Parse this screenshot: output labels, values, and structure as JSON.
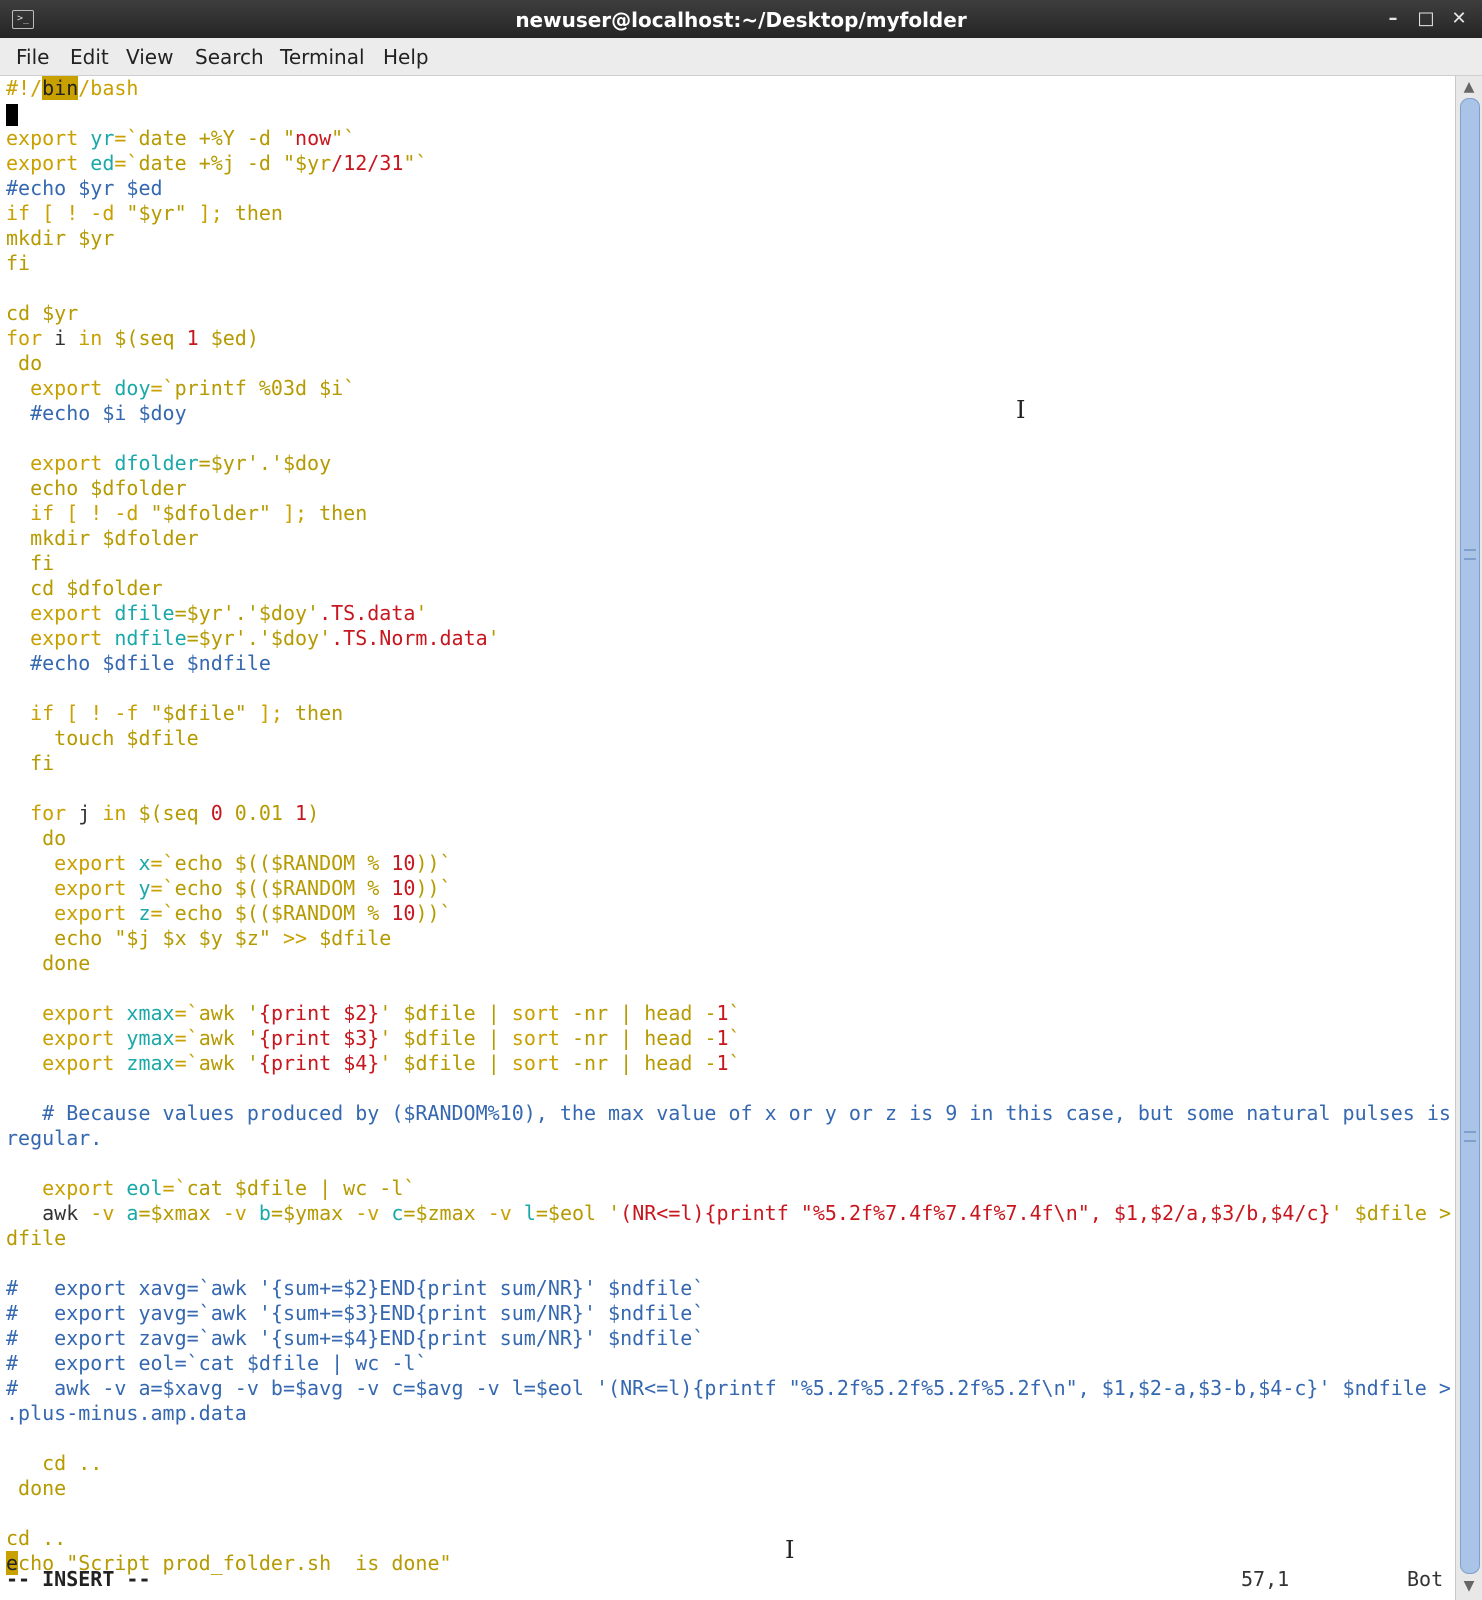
{
  "window": {
    "title": "newuser@localhost:~/Desktop/myfolder"
  },
  "menu": [
    "File",
    "Edit",
    "View",
    "Search",
    "Terminal",
    "Help"
  ],
  "status": {
    "mode": "-- INSERT --",
    "position": "57,1",
    "scroll": "Bot"
  },
  "lines": [
    [
      [
        "#!/",
        "s"
      ],
      [
        "bin",
        "hl"
      ],
      [
        "/bash",
        "s"
      ]
    ],
    [
      [
        "",
        "blk"
      ]
    ],
    [
      [
        "export ",
        "s"
      ],
      [
        "yr",
        "t"
      ],
      [
        "=`",
        "s"
      ],
      [
        "date +%Y -d ",
        "y"
      ],
      [
        "\"",
        "y"
      ],
      [
        "now",
        "r"
      ],
      [
        "\"",
        "y"
      ],
      [
        "`",
        "y"
      ]
    ],
    [
      [
        "export ",
        "s"
      ],
      [
        "ed",
        "t"
      ],
      [
        "=`",
        "s"
      ],
      [
        "date +%j -d ",
        "y"
      ],
      [
        "\"$yr",
        "y"
      ],
      [
        "/12/31",
        "r"
      ],
      [
        "\"`",
        "y"
      ]
    ],
    [
      [
        "#echo $yr $ed",
        "c"
      ]
    ],
    [
      [
        "if [ ! -d ",
        "s"
      ],
      [
        "\"$yr\"",
        "y"
      ],
      [
        " ]; ",
        "s"
      ],
      [
        "then",
        "y"
      ]
    ],
    [
      [
        "mkdir ",
        "y"
      ],
      [
        "$yr",
        "y"
      ]
    ],
    [
      [
        "fi",
        "y"
      ]
    ],
    [],
    [
      [
        "cd ",
        "y"
      ],
      [
        "$yr",
        "y"
      ]
    ],
    [
      [
        "for ",
        "s"
      ],
      [
        "i",
        "d"
      ],
      [
        " in ",
        "s"
      ],
      [
        "$(seq ",
        "y"
      ],
      [
        "1",
        "r"
      ],
      [
        " $ed)",
        "y"
      ]
    ],
    [
      [
        " do",
        "y"
      ]
    ],
    [
      [
        "  export ",
        "s"
      ],
      [
        "doy",
        "t"
      ],
      [
        "=`",
        "s"
      ],
      [
        "printf %03d $i",
        "y"
      ],
      [
        "`",
        "y"
      ]
    ],
    [
      [
        "  #echo $i $doy",
        "c"
      ]
    ],
    [],
    [
      [
        "  export ",
        "s"
      ],
      [
        "dfolder",
        "t"
      ],
      [
        "=$yr'.'$doy",
        "y"
      ]
    ],
    [
      [
        "  echo $dfolder",
        "y"
      ]
    ],
    [
      [
        "  if [ ! -d ",
        "s"
      ],
      [
        "\"$dfolder\"",
        "y"
      ],
      [
        " ]; ",
        "s"
      ],
      [
        "then",
        "y"
      ]
    ],
    [
      [
        "  mkdir $dfolder",
        "y"
      ]
    ],
    [
      [
        "  fi",
        "y"
      ]
    ],
    [
      [
        "  cd $dfolder",
        "y"
      ]
    ],
    [
      [
        "  export ",
        "s"
      ],
      [
        "dfile",
        "t"
      ],
      [
        "=$yr'.'$doy'",
        "y"
      ],
      [
        ".TS.data",
        "r"
      ],
      [
        "'",
        "y"
      ]
    ],
    [
      [
        "  export ",
        "s"
      ],
      [
        "ndfile",
        "t"
      ],
      [
        "=$yr'.'$doy'",
        "y"
      ],
      [
        ".TS.Norm.data",
        "r"
      ],
      [
        "'",
        "y"
      ]
    ],
    [
      [
        "  #echo $dfile $ndfile",
        "c"
      ]
    ],
    [],
    [
      [
        "  if [ ! -f ",
        "s"
      ],
      [
        "\"$dfile\"",
        "y"
      ],
      [
        " ]; ",
        "s"
      ],
      [
        "then",
        "y"
      ]
    ],
    [
      [
        "    touch $dfile",
        "y"
      ]
    ],
    [
      [
        "  fi",
        "y"
      ]
    ],
    [],
    [
      [
        "  for ",
        "s"
      ],
      [
        "j",
        "d"
      ],
      [
        " in ",
        "s"
      ],
      [
        "$(seq ",
        "y"
      ],
      [
        "0",
        "r"
      ],
      [
        " 0.01 ",
        "y"
      ],
      [
        "1",
        "r"
      ],
      [
        ")",
        "y"
      ]
    ],
    [
      [
        "   do",
        "y"
      ]
    ],
    [
      [
        "    export ",
        "s"
      ],
      [
        "x",
        "t"
      ],
      [
        "=`",
        "s"
      ],
      [
        "echo $(($RANDOM % ",
        "y"
      ],
      [
        "10",
        "r"
      ],
      [
        "))`",
        "y"
      ]
    ],
    [
      [
        "    export ",
        "s"
      ],
      [
        "y",
        "t"
      ],
      [
        "=`",
        "s"
      ],
      [
        "echo $(($RANDOM % ",
        "y"
      ],
      [
        "10",
        "r"
      ],
      [
        "))`",
        "y"
      ]
    ],
    [
      [
        "    export ",
        "s"
      ],
      [
        "z",
        "t"
      ],
      [
        "=`",
        "s"
      ],
      [
        "echo $(($RANDOM % ",
        "y"
      ],
      [
        "10",
        "r"
      ],
      [
        "))`",
        "y"
      ]
    ],
    [
      [
        "    echo ",
        "y"
      ],
      [
        "\"$j $x $y $z\"",
        "y"
      ],
      [
        " >> ",
        "s"
      ],
      [
        "$dfile",
        "y"
      ]
    ],
    [
      [
        "   done",
        "y"
      ]
    ],
    [],
    [
      [
        "   export ",
        "s"
      ],
      [
        "xmax",
        "t"
      ],
      [
        "=`",
        "s"
      ],
      [
        "awk '",
        "y"
      ],
      [
        "{print $2}",
        "r"
      ],
      [
        "' $dfile | ",
        "y"
      ],
      [
        "sort",
        "s"
      ],
      [
        " -nr | head -",
        "y"
      ],
      [
        "1",
        "r"
      ],
      [
        "`",
        "y"
      ]
    ],
    [
      [
        "   export ",
        "s"
      ],
      [
        "ymax",
        "t"
      ],
      [
        "=`",
        "s"
      ],
      [
        "awk '",
        "y"
      ],
      [
        "{print $3}",
        "r"
      ],
      [
        "' $dfile | ",
        "y"
      ],
      [
        "sort",
        "s"
      ],
      [
        " -nr | head -",
        "y"
      ],
      [
        "1",
        "r"
      ],
      [
        "`",
        "y"
      ]
    ],
    [
      [
        "   export ",
        "s"
      ],
      [
        "zmax",
        "t"
      ],
      [
        "=`",
        "s"
      ],
      [
        "awk '",
        "y"
      ],
      [
        "{print $4}",
        "r"
      ],
      [
        "' $dfile | ",
        "y"
      ],
      [
        "sort",
        "s"
      ],
      [
        " -nr | head -",
        "y"
      ],
      [
        "1",
        "r"
      ],
      [
        "`",
        "y"
      ]
    ],
    [],
    [
      [
        "   # Because values produced by ($RANDOM%10), the max value of x or y or z is 9 in this case, but some natural pulses is ir",
        "c"
      ]
    ],
    [
      [
        "regular.",
        "c"
      ]
    ],
    [],
    [
      [
        "   export ",
        "s"
      ],
      [
        "eol",
        "t"
      ],
      [
        "=`",
        "s"
      ],
      [
        "cat $dfile | wc -l",
        "y"
      ],
      [
        "`",
        "y"
      ]
    ],
    [
      [
        "   awk",
        "d"
      ],
      [
        " -v ",
        "s"
      ],
      [
        "a",
        "t"
      ],
      [
        "=$xmax",
        "y"
      ],
      [
        " -v ",
        "s"
      ],
      [
        "b",
        "t"
      ],
      [
        "=$ymax",
        "y"
      ],
      [
        " -v ",
        "s"
      ],
      [
        "c",
        "t"
      ],
      [
        "=$zmax",
        "y"
      ],
      [
        " -v ",
        "s"
      ],
      [
        "l",
        "t"
      ],
      [
        "=$eol '",
        "y"
      ],
      [
        "(NR<=l){printf \"%5.2f%7.4f%7.4f%7.4f\\n\", $1,$2/a,$3/b,$4/c}",
        "r"
      ],
      [
        "' $dfile > $n",
        "y"
      ]
    ],
    [
      [
        "dfile",
        "y"
      ]
    ],
    [],
    [
      [
        "#   export xavg=`awk '{sum+=$2}END{print sum/NR}' $ndfile`",
        "c"
      ]
    ],
    [
      [
        "#   export yavg=`awk '{sum+=$3}END{print sum/NR}' $ndfile`",
        "c"
      ]
    ],
    [
      [
        "#   export zavg=`awk '{sum+=$4}END{print sum/NR}' $ndfile`",
        "c"
      ]
    ],
    [
      [
        "#   export eol=`cat $dfile | wc -l`",
        "c"
      ]
    ],
    [
      [
        "#   awk -v a=$xavg -v b=$avg -v c=$avg -v l=$eol '(NR<=l){printf \"%5.2f%5.2f%5.2f%5.2f\\n\", $1,$2-a,$3-b,$4-c}' $ndfile > TS",
        "c"
      ]
    ],
    [
      [
        ".plus-minus.amp.data",
        "c"
      ]
    ],
    [],
    [
      [
        "   cd ..",
        "y"
      ]
    ],
    [
      [
        " done",
        "y"
      ]
    ],
    [],
    [
      [
        "cd ..",
        "y"
      ]
    ],
    [
      [
        "e",
        "curs"
      ],
      [
        "cho ",
        "y"
      ],
      [
        "\"Script prod_folder.sh  is done\"",
        "y"
      ]
    ]
  ]
}
